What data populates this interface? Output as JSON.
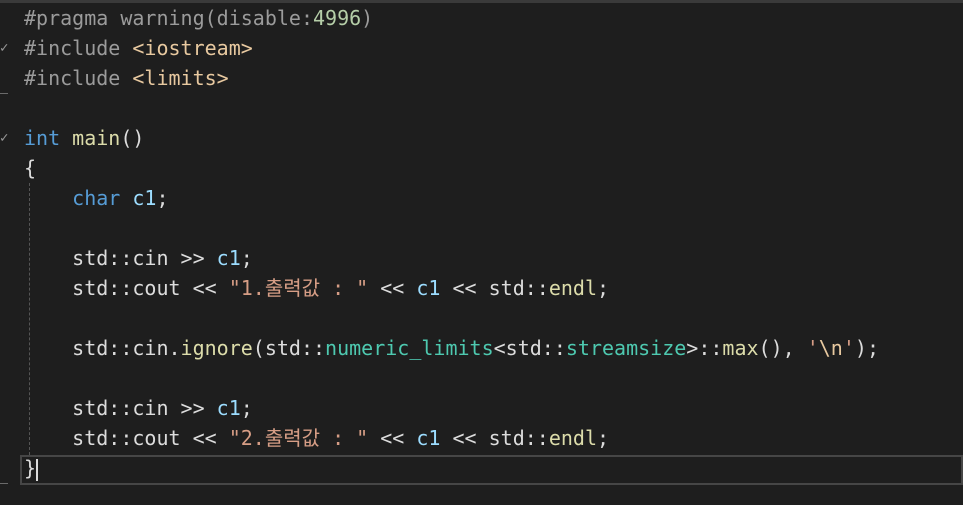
{
  "editor": {
    "lines": [
      {
        "tokens": [
          {
            "t": "#pragma warning(disable:",
            "c": "pp"
          },
          {
            "t": "4996",
            "c": "num"
          },
          {
            "t": ")",
            "c": "pp"
          }
        ]
      },
      {
        "tokens": [
          {
            "t": "#include ",
            "c": "pp"
          },
          {
            "t": "<iostream>",
            "c": "inc"
          }
        ]
      },
      {
        "tokens": [
          {
            "t": "#include ",
            "c": "pp"
          },
          {
            "t": "<limits>",
            "c": "inc"
          }
        ]
      },
      {
        "tokens": []
      },
      {
        "tokens": [
          {
            "t": "int",
            "c": "kw"
          },
          {
            "t": " ",
            "c": "plain"
          },
          {
            "t": "main",
            "c": "fn"
          },
          {
            "t": "()",
            "c": "plain"
          }
        ]
      },
      {
        "tokens": [
          {
            "t": "{",
            "c": "plain"
          }
        ]
      },
      {
        "tokens": [
          {
            "t": "    ",
            "c": "plain"
          },
          {
            "t": "char",
            "c": "kw"
          },
          {
            "t": " ",
            "c": "plain"
          },
          {
            "t": "c1",
            "c": "var"
          },
          {
            "t": ";",
            "c": "plain"
          }
        ]
      },
      {
        "tokens": []
      },
      {
        "tokens": [
          {
            "t": "    std::cin >> ",
            "c": "plain"
          },
          {
            "t": "c1",
            "c": "var"
          },
          {
            "t": ";",
            "c": "plain"
          }
        ]
      },
      {
        "tokens": [
          {
            "t": "    std::cout << ",
            "c": "plain"
          },
          {
            "t": "\"1.출력값 : \"",
            "c": "str"
          },
          {
            "t": " << ",
            "c": "plain"
          },
          {
            "t": "c1",
            "c": "var"
          },
          {
            "t": " << std::",
            "c": "plain"
          },
          {
            "t": "endl",
            "c": "fn"
          },
          {
            "t": ";",
            "c": "plain"
          }
        ]
      },
      {
        "tokens": []
      },
      {
        "tokens": [
          {
            "t": "    std::cin.",
            "c": "plain"
          },
          {
            "t": "ignore",
            "c": "fn"
          },
          {
            "t": "(std::",
            "c": "plain"
          },
          {
            "t": "numeric_limits",
            "c": "type"
          },
          {
            "t": "<std::",
            "c": "plain"
          },
          {
            "t": "streamsize",
            "c": "type"
          },
          {
            "t": ">::",
            "c": "plain"
          },
          {
            "t": "max",
            "c": "fn"
          },
          {
            "t": "(), ",
            "c": "plain"
          },
          {
            "t": "'",
            "c": "str"
          },
          {
            "t": "\\n",
            "c": "esc"
          },
          {
            "t": "'",
            "c": "str"
          },
          {
            "t": ");",
            "c": "plain"
          }
        ]
      },
      {
        "tokens": []
      },
      {
        "tokens": [
          {
            "t": "    std::cin >> ",
            "c": "plain"
          },
          {
            "t": "c1",
            "c": "var"
          },
          {
            "t": ";",
            "c": "plain"
          }
        ]
      },
      {
        "tokens": [
          {
            "t": "    std::cout << ",
            "c": "plain"
          },
          {
            "t": "\"2.출력값 : \"",
            "c": "str"
          },
          {
            "t": " << ",
            "c": "plain"
          },
          {
            "t": "c1",
            "c": "var"
          },
          {
            "t": " << std::",
            "c": "plain"
          },
          {
            "t": "endl",
            "c": "fn"
          },
          {
            "t": ";",
            "c": "plain"
          }
        ]
      },
      {
        "tokens": [
          {
            "t": "}",
            "c": "plain"
          }
        ],
        "caret": true
      }
    ]
  }
}
